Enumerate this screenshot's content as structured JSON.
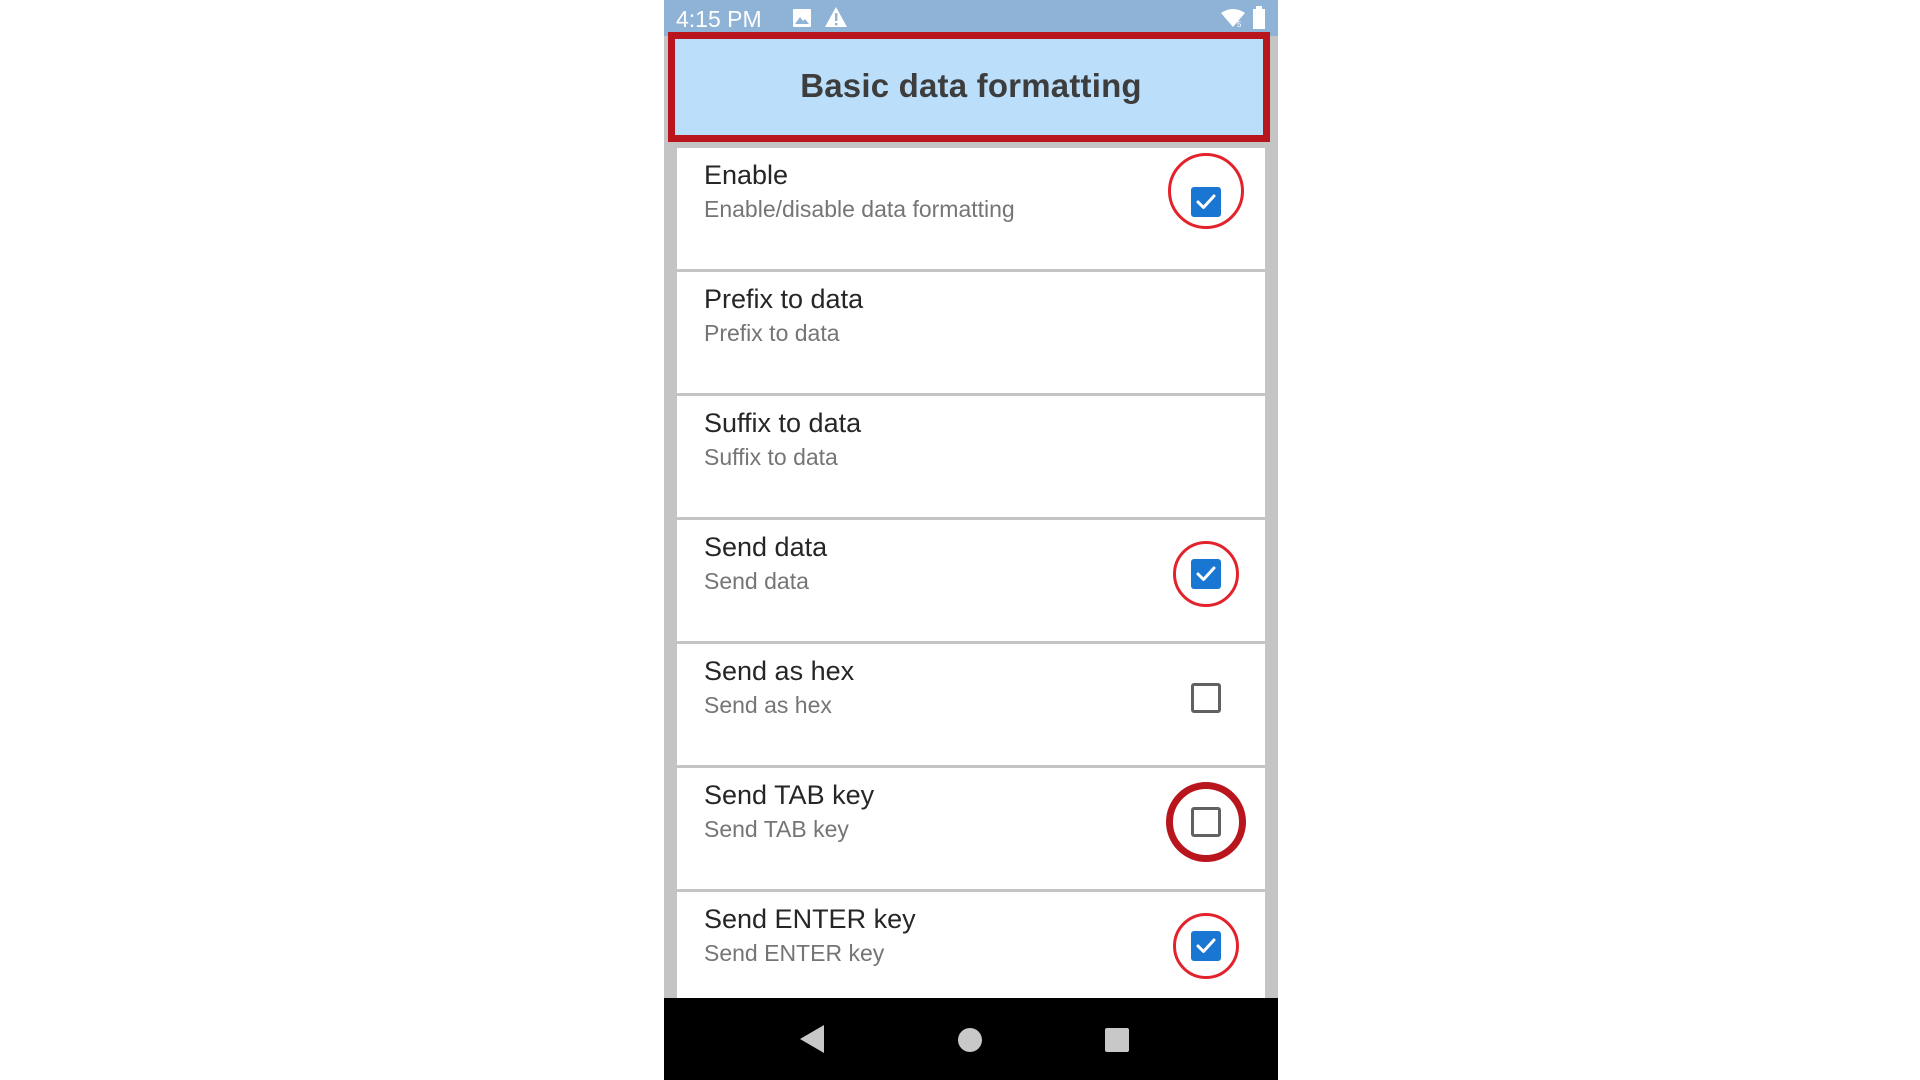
{
  "status_bar": {
    "time": "4:15 PM",
    "icons": [
      "image-icon",
      "warning-icon",
      "wifi-icon",
      "battery-icon"
    ]
  },
  "app_bar": {
    "title": "Basic data formatting"
  },
  "settings": [
    {
      "title": "Enable",
      "summary": "Enable/disable data formatting",
      "checkbox": "checked"
    },
    {
      "title": "Prefix to data",
      "summary": "Prefix to data",
      "checkbox": "none"
    },
    {
      "title": "Suffix to data",
      "summary": "Suffix to data",
      "checkbox": "none"
    },
    {
      "title": "Send data",
      "summary": "Send data",
      "checkbox": "checked"
    },
    {
      "title": "Send as hex",
      "summary": "Send as hex",
      "checkbox": "unchecked"
    },
    {
      "title": "Send TAB key",
      "summary": "Send TAB key",
      "checkbox": "unchecked"
    },
    {
      "title": "Send ENTER key",
      "summary": "Send ENTER key",
      "checkbox": "checked"
    }
  ],
  "navigation": {
    "buttons": [
      "back-icon",
      "home-icon",
      "recents-icon"
    ]
  },
  "colors": {
    "app_bar": "#bbdefb",
    "status_bar": "#8fb3d6",
    "checkbox_checked": "#1976d2",
    "highlight_red": "#b9151d"
  }
}
